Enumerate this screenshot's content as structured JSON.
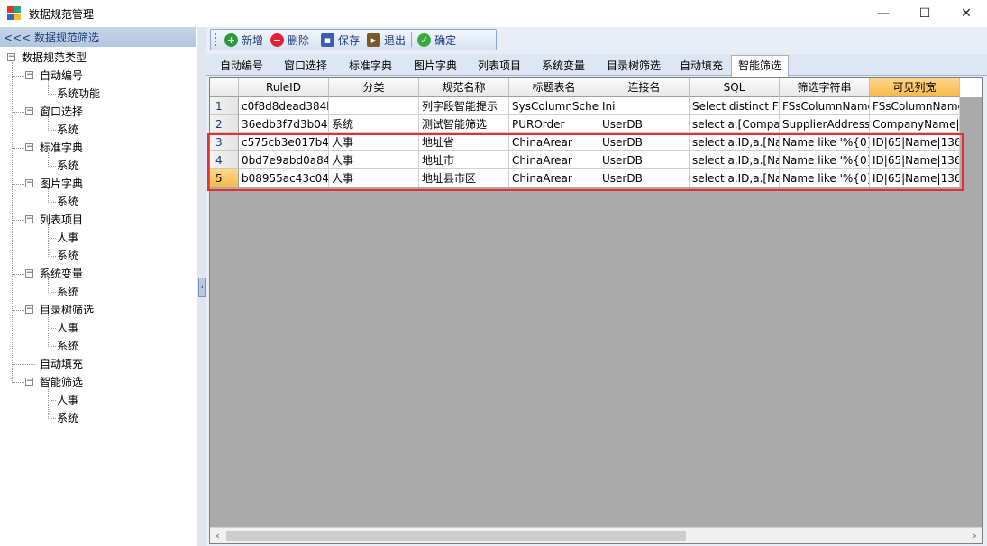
{
  "window": {
    "title": "数据规范管理",
    "min": "—",
    "max": "☐",
    "close": "✕"
  },
  "left_panel": {
    "header": "<<< 数据规范筛选",
    "tree": {
      "root": "数据规范类型",
      "groups": [
        {
          "label": "自动编号",
          "children": [
            "系统功能"
          ]
        },
        {
          "label": "窗口选择",
          "children": [
            "系统"
          ]
        },
        {
          "label": "标准字典",
          "children": [
            "系统"
          ]
        },
        {
          "label": "图片字典",
          "children": [
            "系统"
          ]
        },
        {
          "label": "列表项目",
          "children": [
            "人事",
            "系统"
          ]
        },
        {
          "label": "系统变量",
          "children": [
            "系统"
          ]
        },
        {
          "label": "目录树筛选",
          "children": [
            "人事",
            "系统"
          ]
        },
        {
          "label": "自动填充",
          "children": []
        },
        {
          "label": "智能筛选",
          "children": [
            "人事",
            "系统"
          ]
        }
      ]
    }
  },
  "toolbar": {
    "add": "新增",
    "delete": "删除",
    "save": "保存",
    "exit": "退出",
    "ok": "确定"
  },
  "tabs": [
    "自动编号",
    "窗口选择",
    "标准字典",
    "图片字典",
    "列表项目",
    "系统变量",
    "目录树筛选",
    "自动填充",
    "智能筛选"
  ],
  "active_tab": "智能筛选",
  "grid": {
    "columns": [
      "RuleID",
      "分类",
      "规范名称",
      "标题表名",
      "连接名",
      "SQL",
      "筛选字符串",
      "可见列宽"
    ],
    "rows": [
      {
        "no": "1",
        "cells": [
          "c0f8d8dead384k",
          "",
          "列字段智能提示",
          "SysColumnScher",
          "Ini",
          "Select distinct FS",
          "FSsColumnName",
          "FSsColumnName"
        ]
      },
      {
        "no": "2",
        "cells": [
          "36edb3f7d3b04l",
          "系统",
          "测试智能筛选",
          "PUROrder",
          "UserDB",
          "select a.[Compa",
          "SupplierAddress",
          "CompanyName|"
        ]
      },
      {
        "no": "3",
        "cells": [
          "c575cb3e017b4l",
          "人事",
          "地址省",
          "ChinaArear",
          "UserDB",
          "select a.ID,a.[Na",
          "Name like '%{0}'",
          "ID|65|Name|136"
        ]
      },
      {
        "no": "4",
        "cells": [
          "0bd7e9abd0a84",
          "人事",
          "地址市",
          "ChinaArear",
          "UserDB",
          "select a.ID,a.[Na",
          "Name like '%{0}'",
          "ID|65|Name|136"
        ]
      },
      {
        "no": "5",
        "cells": [
          "b08955ac43c043",
          "人事",
          "地址县市区",
          "ChinaArear",
          "UserDB",
          "select a.ID,a.[Na",
          "Name like '%{0}'",
          "ID|65|Name|136"
        ]
      }
    ]
  },
  "colors": {
    "highlight": "#f7b94a",
    "selection_box": "#e53030",
    "grid_bg": "#aaaaaa"
  }
}
